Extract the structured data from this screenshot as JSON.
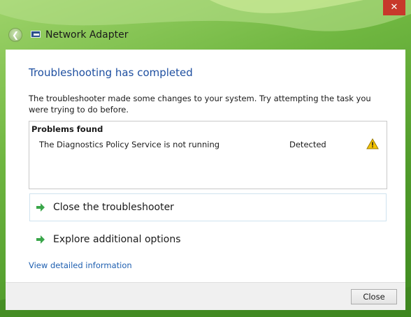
{
  "window": {
    "title": "Network Adapter",
    "close_glyph": "✕"
  },
  "main": {
    "heading": "Troubleshooting has completed",
    "description": "The troubleshooter made some changes to your system. Try attempting the task you were trying to do before.",
    "problems": {
      "title": "Problems found",
      "items": [
        {
          "text": "The Diagnostics Policy Service is not running",
          "status": "Detected",
          "icon": "warning-icon"
        }
      ]
    },
    "commands": [
      {
        "label": "Close the troubleshooter",
        "icon": "green-arrow-icon"
      },
      {
        "label": "Explore additional options",
        "icon": "green-arrow-icon"
      }
    ],
    "detail_link": "View detailed information"
  },
  "footer": {
    "close_label": "Close"
  },
  "colors": {
    "heading": "#1e4fa0",
    "link": "#1e5fb0",
    "accent_green": "#3aa64a",
    "close_red": "#c7382b"
  }
}
